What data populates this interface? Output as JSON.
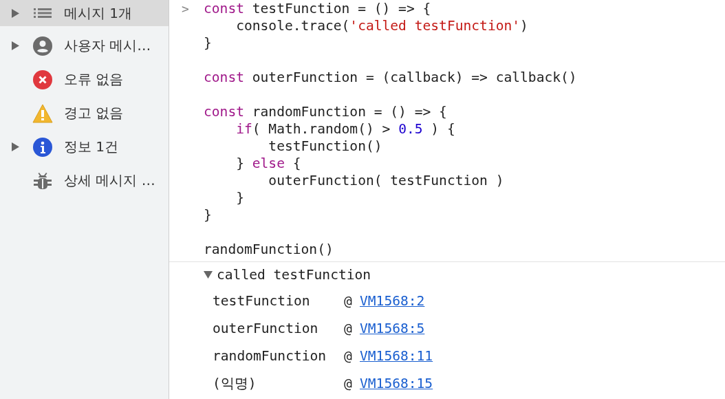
{
  "sidebar": {
    "items": [
      {
        "label": "메시지 1개",
        "kind": "list",
        "expandable": true,
        "selected": true
      },
      {
        "label": "사용자 메시…",
        "kind": "user",
        "expandable": true,
        "selected": false
      },
      {
        "label": "오류 없음",
        "kind": "error",
        "expandable": false,
        "selected": false
      },
      {
        "label": "경고 없음",
        "kind": "warning",
        "expandable": false,
        "selected": false
      },
      {
        "label": "정보 1건",
        "kind": "info",
        "expandable": true,
        "selected": false
      },
      {
        "label": "상세 메시지 …",
        "kind": "bug",
        "expandable": false,
        "selected": false
      }
    ]
  },
  "console": {
    "prompt": ">",
    "code_lines": [
      {
        "kind": "code",
        "tokens": [
          {
            "text": "const",
            "kind": "keyword"
          },
          {
            "text": " testFunction = () => {",
            "kind": "plain"
          }
        ]
      },
      {
        "kind": "code",
        "tokens": [
          {
            "text": "    console.trace(",
            "kind": "plain"
          },
          {
            "text": "'called testFunction'",
            "kind": "string"
          },
          {
            "text": ")",
            "kind": "plain"
          }
        ]
      },
      {
        "kind": "code",
        "tokens": [
          {
            "text": "}",
            "kind": "plain"
          }
        ]
      },
      {
        "kind": "blank"
      },
      {
        "kind": "code",
        "tokens": [
          {
            "text": "const",
            "kind": "keyword"
          },
          {
            "text": " outerFunction = (callback) => callback()",
            "kind": "plain"
          }
        ]
      },
      {
        "kind": "blank"
      },
      {
        "kind": "code",
        "tokens": [
          {
            "text": "const",
            "kind": "keyword"
          },
          {
            "text": " randomFunction = () => {",
            "kind": "plain"
          }
        ]
      },
      {
        "kind": "code",
        "tokens": [
          {
            "text": "    if",
            "kind": "keyword"
          },
          {
            "text": "( Math.random() > ",
            "kind": "plain"
          },
          {
            "text": "0.5",
            "kind": "number"
          },
          {
            "text": " ) {",
            "kind": "plain"
          }
        ]
      },
      {
        "kind": "code",
        "tokens": [
          {
            "text": "        testFunction()",
            "kind": "plain"
          }
        ]
      },
      {
        "kind": "code",
        "tokens": [
          {
            "text": "    } ",
            "kind": "plain"
          },
          {
            "text": "else",
            "kind": "keyword"
          },
          {
            "text": " {",
            "kind": "plain"
          }
        ]
      },
      {
        "kind": "code",
        "tokens": [
          {
            "text": "        outerFunction( testFunction )",
            "kind": "plain"
          }
        ]
      },
      {
        "kind": "code",
        "tokens": [
          {
            "text": "    }",
            "kind": "plain"
          }
        ]
      },
      {
        "kind": "code",
        "tokens": [
          {
            "text": "}",
            "kind": "plain"
          }
        ]
      },
      {
        "kind": "blank"
      },
      {
        "kind": "code",
        "tokens": [
          {
            "text": "randomFunction()",
            "kind": "plain"
          }
        ]
      }
    ],
    "trace": {
      "message": "called testFunction",
      "expanded": true,
      "frames": [
        {
          "function": "testFunction",
          "at": "@",
          "location": "VM1568:2"
        },
        {
          "function": "outerFunction",
          "at": "@",
          "location": "VM1568:5"
        },
        {
          "function": "randomFunction",
          "at": "@",
          "location": "VM1568:11"
        },
        {
          "function": "(익명)",
          "at": "@",
          "location": "VM1568:15"
        }
      ]
    }
  }
}
